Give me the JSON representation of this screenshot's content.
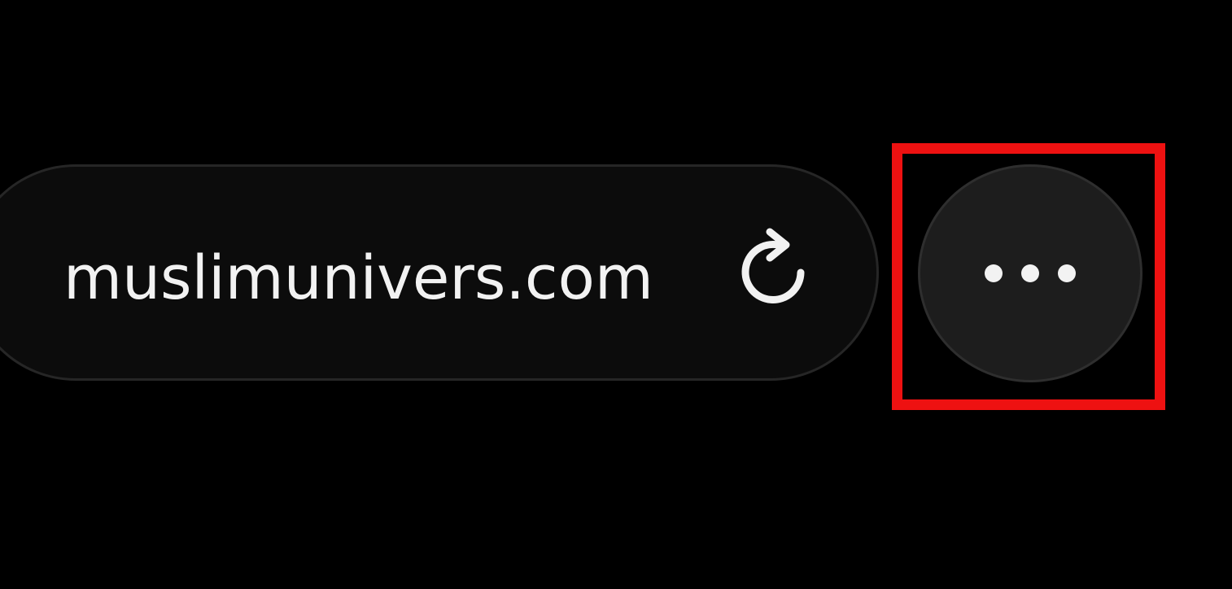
{
  "address_bar": {
    "domain": "muslimunivers.com",
    "reload_icon": "reload-icon"
  },
  "more_button": {
    "icon": "ellipsis-icon"
  },
  "highlight": {
    "color": "#ee1111"
  },
  "colors": {
    "background": "#000000",
    "bar_fill": "#0c0c0c",
    "text": "#f2f2f2",
    "button_fill": "#1d1d1d"
  }
}
